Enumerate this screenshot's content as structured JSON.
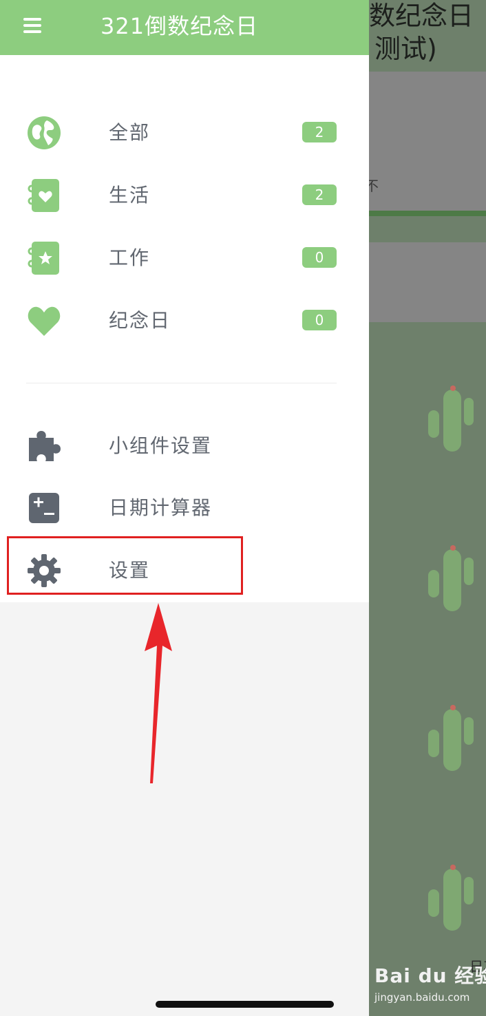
{
  "app": {
    "title": "321倒数纪念日"
  },
  "background": {
    "title_line1": "数纪念日",
    "title_line2": "测试)",
    "card_text": "不",
    "footer_text": "日其"
  },
  "categories": [
    {
      "label": "全部",
      "count": "2",
      "icon": "globe-icon"
    },
    {
      "label": "生活",
      "count": "2",
      "icon": "notebook-heart-icon"
    },
    {
      "label": "工作",
      "count": "0",
      "icon": "notebook-star-icon"
    },
    {
      "label": "纪念日",
      "count": "0",
      "icon": "heart-icon"
    }
  ],
  "tools": [
    {
      "label": "小组件设置",
      "icon": "puzzle-icon"
    },
    {
      "label": "日期计算器",
      "icon": "calculator-icon"
    },
    {
      "label": "设置",
      "icon": "gear-icon"
    }
  ],
  "watermark": {
    "brand": "Bai du 经验",
    "url": "jingyan.baidu.com"
  },
  "colors": {
    "accent": "#8dcd7f",
    "icon_gray": "#5f6670",
    "highlight": "#e02020"
  }
}
